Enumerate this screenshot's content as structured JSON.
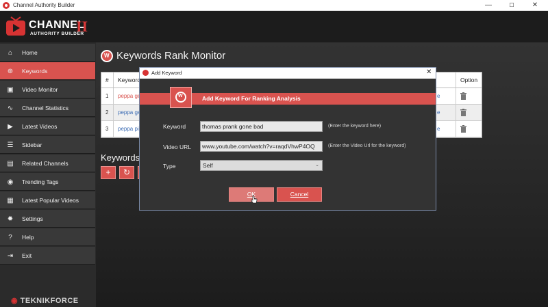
{
  "window": {
    "title": "Channel Authority Builder",
    "controls": [
      "—",
      "☐",
      "✕"
    ]
  },
  "logo": {
    "line1": "CHANNEL",
    "line2": "AUTHORITY BUILDER",
    "roman": "II"
  },
  "sidebar": {
    "items": [
      {
        "label": "Home",
        "icon": "home-icon",
        "glyph": "⌂"
      },
      {
        "label": "Keywords",
        "icon": "keyword-search-icon",
        "glyph": "⊕"
      },
      {
        "label": "Video Monitor",
        "icon": "video-monitor-icon",
        "glyph": "▣"
      },
      {
        "label": "Channel Statistics",
        "icon": "statistics-icon",
        "glyph": "∿"
      },
      {
        "label": "Latest Videos",
        "icon": "latest-videos-icon",
        "glyph": "▶"
      },
      {
        "label": "Sidebar",
        "icon": "sidebar-list-icon",
        "glyph": "☰"
      },
      {
        "label": "Related Channels",
        "icon": "related-channels-icon",
        "glyph": "▤"
      },
      {
        "label": "Trending Tags",
        "icon": "trending-tags-icon",
        "glyph": "◉"
      },
      {
        "label": "Latest Popular Videos",
        "icon": "popular-videos-icon",
        "glyph": "▦"
      },
      {
        "label": "Settings",
        "icon": "gear-icon",
        "glyph": "✹"
      },
      {
        "label": "Help",
        "icon": "help-icon",
        "glyph": "?"
      },
      {
        "label": "Exit",
        "icon": "exit-icon",
        "glyph": "⇥"
      }
    ],
    "active_index": 1,
    "footer_brand": "TEKNIKFORCE"
  },
  "main": {
    "title": "Keywords Rank Monitor",
    "table": {
      "headers": {
        "num": "#",
        "keyword": "Keyword",
        "option": "Option"
      },
      "rows": [
        {
          "num": "1",
          "keyword": "peppa ge",
          "tail": "e"
        },
        {
          "num": "2",
          "keyword": "peppa ge",
          "tail": "e"
        },
        {
          "num": "3",
          "keyword": "peppa pi",
          "tail": "e"
        }
      ]
    },
    "section_heading": "Keywords",
    "toolbar": [
      "+",
      "↻"
    ]
  },
  "dialog": {
    "title": "Add Keyword",
    "banner": "Add Keyword For Ranking Analysis",
    "keyword": {
      "label": "Keyword",
      "value": "thomas prank gone bad",
      "hint": "(Enter the keyword here)"
    },
    "video_url": {
      "label": "Video URL",
      "value": "www.youtube.com/watch?v=raqdVhwP4OQ",
      "hint": "(Enter the Video Url for the keyword)"
    },
    "type": {
      "label": "Type",
      "value": "Self"
    },
    "ok_label": "OK",
    "cancel_label": "Cancel"
  },
  "colors": {
    "accent": "#d9534f",
    "sidebar_bg": "#393939",
    "header_bg": "#1c1c1c",
    "dialog_bg": "#333333"
  }
}
